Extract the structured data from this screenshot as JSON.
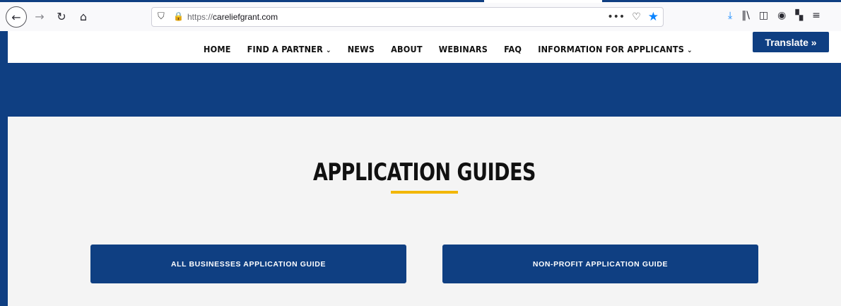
{
  "browser": {
    "url_protocol": "https://",
    "url_host": "careliefgrant.com",
    "icons": {
      "back": "back-arrow-icon",
      "forward": "forward-arrow-icon",
      "reload": "reload-icon",
      "home": "home-icon",
      "shield": "tracking-shield-icon",
      "lock": "lock-icon",
      "more": "more-icon",
      "pocket": "pocket-icon",
      "bookmark": "bookmark-star-icon",
      "download": "download-icon",
      "library": "library-icon",
      "sidebar": "sidebar-icon",
      "account": "account-icon",
      "extensions": "extensions-icon",
      "menu": "hamburger-menu-icon"
    },
    "more_label": "•••"
  },
  "site": {
    "nav": {
      "items": [
        {
          "label": "HOME"
        },
        {
          "label": "FIND A PARTNER",
          "has_dropdown": true
        },
        {
          "label": "NEWS"
        },
        {
          "label": "ABOUT"
        },
        {
          "label": "WEBINARS"
        },
        {
          "label": "FAQ"
        },
        {
          "label": "INFORMATION FOR APPLICANTS",
          "has_dropdown": true
        }
      ],
      "dropdown_glyph": "⌄"
    },
    "translate_label": "Translate »",
    "section_title": "APPLICATION GUIDES",
    "buttons": {
      "left": "ALL BUSINESSES APPLICATION GUIDE",
      "right": "NON-PROFIT APPLICATION GUIDE"
    },
    "colors": {
      "brand_blue": "#0f3f82",
      "accent_gold": "#f2b705",
      "page_bg": "#f4f4f4"
    }
  }
}
